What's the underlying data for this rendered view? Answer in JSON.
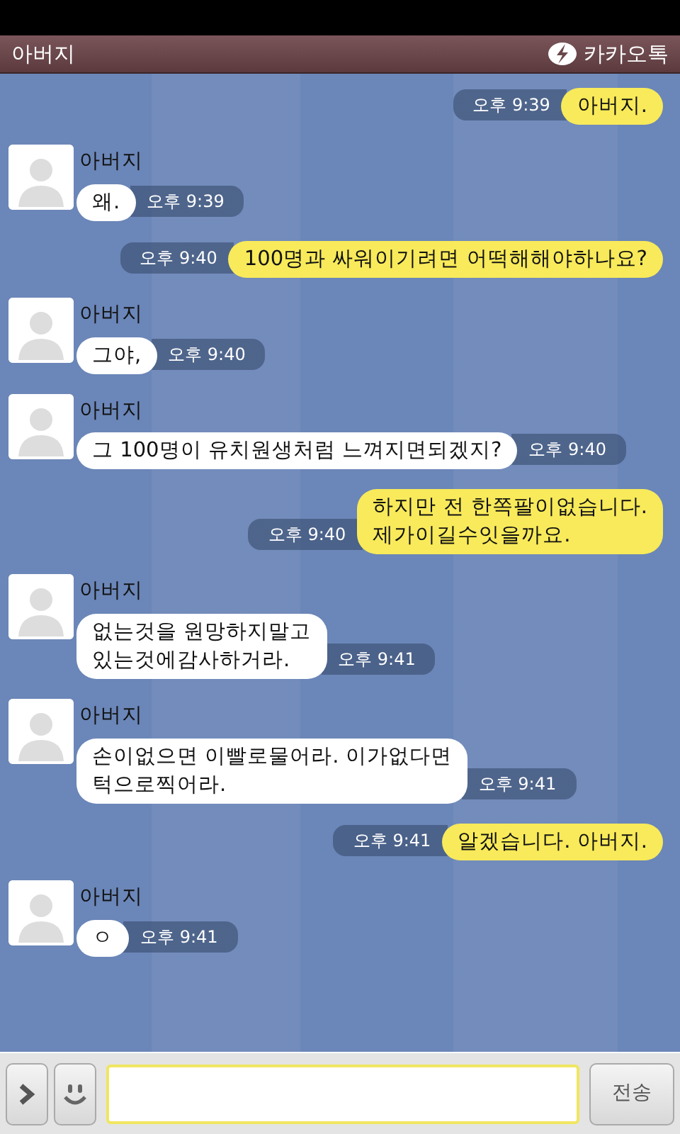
{
  "header": {
    "title": "아버지",
    "app_name": "카카오톡"
  },
  "messages": [
    {
      "kind": "sent",
      "text": "아버지.",
      "time": "오후 9:39"
    },
    {
      "kind": "received",
      "sender": "아버지",
      "text": "왜.",
      "time": "오후 9:39"
    },
    {
      "kind": "sent",
      "text": "100명과 싸워이기려면 어떡해해야하나요?",
      "time": "오후 9:40"
    },
    {
      "kind": "received",
      "sender": "아버지",
      "text": "그야,",
      "time": "오후 9:40"
    },
    {
      "kind": "received",
      "sender": "아버지",
      "text": "그 100명이 유치원생처럼 느껴지면되겠지?",
      "time": "오후 9:40"
    },
    {
      "kind": "sent",
      "text": "하지만 전 한쪽팔이없습니다.\n제가이길수잇을까요.",
      "time": "오후 9:40"
    },
    {
      "kind": "received",
      "sender": "아버지",
      "text": "없는것을 원망하지말고\n있는것에감사하거라.",
      "time": "오후 9:41"
    },
    {
      "kind": "received",
      "sender": "아버지",
      "text": "손이없으면 이빨로물어라. 이가없다면\n턱으로찍어라.",
      "time": "오후 9:41"
    },
    {
      "kind": "sent",
      "text": "알겠습니다. 아버지.",
      "time": "오후 9:41"
    },
    {
      "kind": "received",
      "sender": "아버지",
      "text": "ㅇ",
      "time": "오후 9:41"
    }
  ],
  "composer": {
    "send_label": "전송"
  }
}
